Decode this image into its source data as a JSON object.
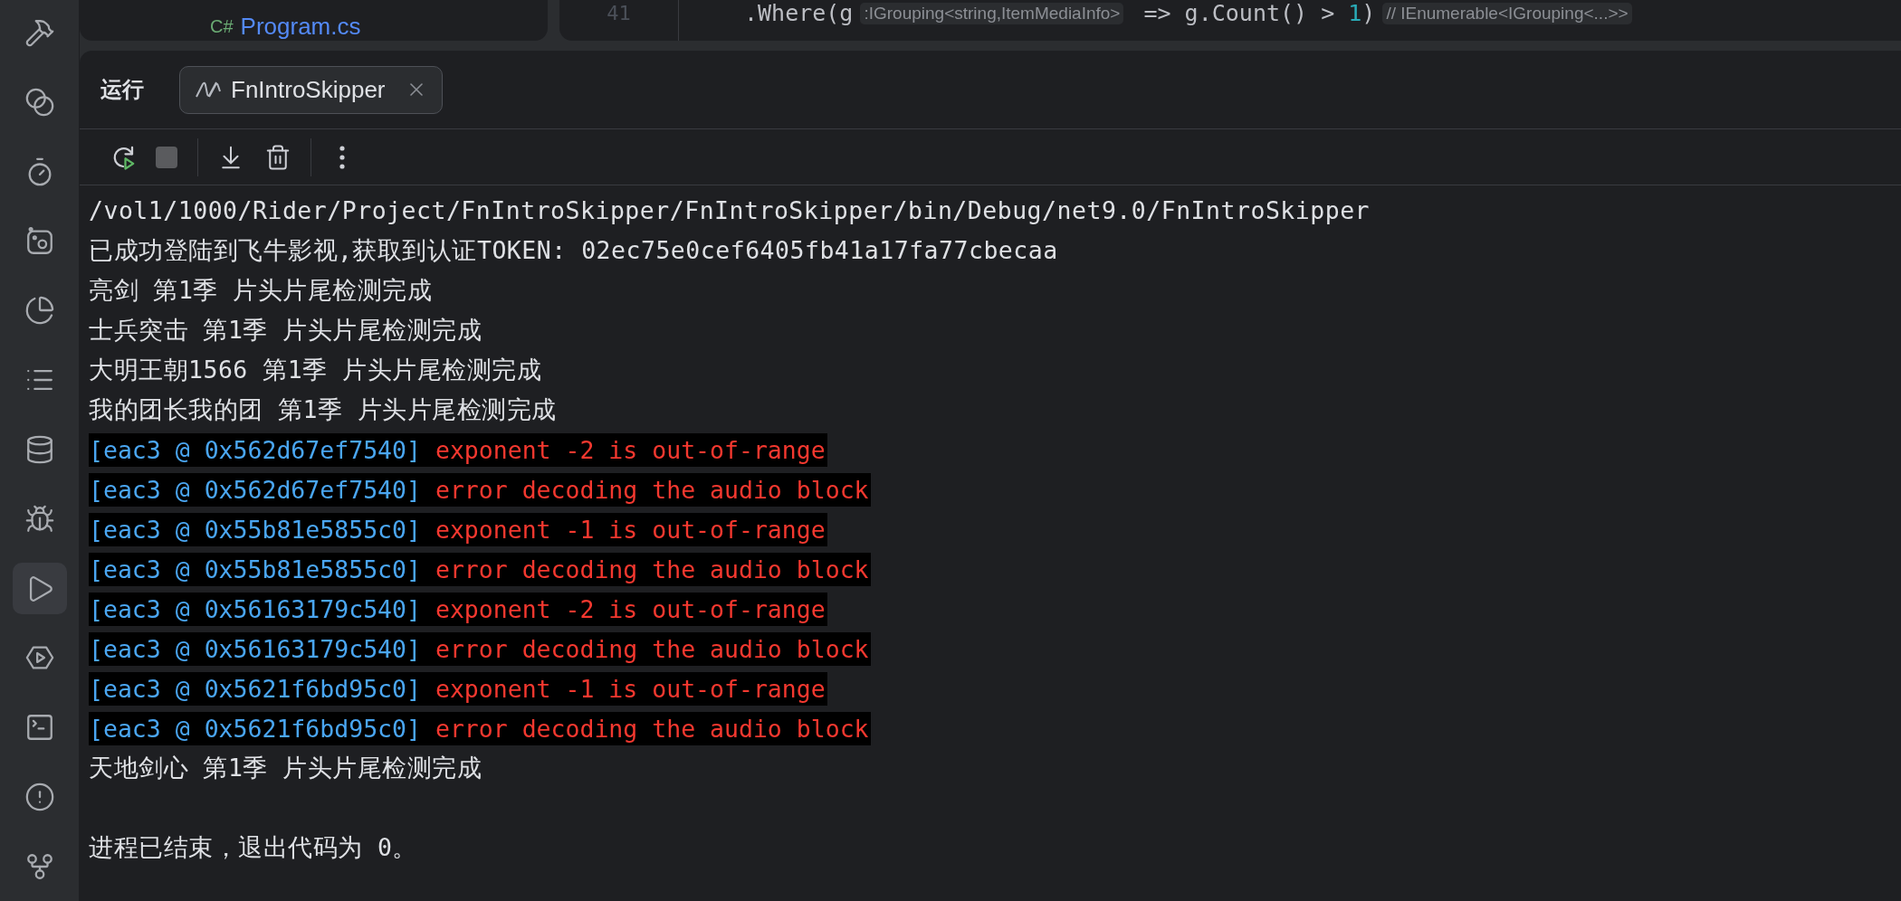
{
  "project_panel": {
    "file": {
      "lang": "C#",
      "name": "Program.cs"
    }
  },
  "editor": {
    "line_number": "41",
    "code_before": ".Where(g",
    "inlay_hint": ":IGrouping<string,ItemMediaInfo>",
    "code_after": "=> g.Count() > ",
    "number": "1",
    "code_end": ")",
    "type_hint": "// IEnumerable<IGrouping<...>>"
  },
  "tool_strip": [
    {
      "kind": "hammer",
      "selected": false
    },
    {
      "kind": "services",
      "selected": false
    },
    {
      "kind": "timer",
      "selected": false
    },
    {
      "kind": "dotsquare",
      "selected": false
    },
    {
      "kind": "pie",
      "selected": false
    },
    {
      "kind": "list",
      "selected": false
    },
    {
      "kind": "database",
      "selected": false
    },
    {
      "kind": "bug",
      "selected": false
    },
    {
      "kind": "run",
      "selected": true
    },
    {
      "kind": "hexplay",
      "selected": false
    },
    {
      "kind": "terminal",
      "selected": false
    },
    {
      "kind": "alert",
      "selected": false
    },
    {
      "kind": "branch",
      "selected": false
    }
  ],
  "run_panel": {
    "title": "运行",
    "tabs": [
      {
        "label": "FnIntroSkipper",
        "selected": true
      }
    ],
    "toolbar": [
      {
        "kind": "rerun"
      },
      {
        "kind": "stop",
        "disabled": true
      },
      {
        "kind": "separator"
      },
      {
        "kind": "scroll"
      },
      {
        "kind": "clear"
      },
      {
        "kind": "separator"
      },
      {
        "kind": "more"
      }
    ],
    "console": [
      {
        "kind": "plain",
        "text": "/vol1/1000/Rider/Project/FnIntroSkipper/FnIntroSkipper/bin/Debug/net9.0/FnIntroSkipper"
      },
      {
        "kind": "plain",
        "text": "已成功登陆到飞牛影视,获取到认证TOKEN: 02ec75e0cef6405fb41a17fa77cbecaa"
      },
      {
        "kind": "plain",
        "text": "亮剑 第1季 片头片尾检测完成"
      },
      {
        "kind": "plain",
        "text": "士兵突击 第1季 片头片尾检测完成"
      },
      {
        "kind": "plain",
        "text": "大明王朝1566 第1季 片头片尾检测完成"
      },
      {
        "kind": "plain",
        "text": "我的团长我的团 第1季 片头片尾检测完成"
      },
      {
        "kind": "error",
        "source": "[eac3 @ 0x562d67ef7540]",
        "text": "exponent -2 is out-of-range"
      },
      {
        "kind": "error",
        "source": "[eac3 @ 0x562d67ef7540]",
        "text": "error decoding the audio block"
      },
      {
        "kind": "error",
        "source": "[eac3 @ 0x55b81e5855c0]",
        "text": "exponent -1 is out-of-range"
      },
      {
        "kind": "error",
        "source": "[eac3 @ 0x55b81e5855c0]",
        "text": "error decoding the audio block"
      },
      {
        "kind": "error",
        "source": "[eac3 @ 0x56163179c540]",
        "text": "exponent -2 is out-of-range"
      },
      {
        "kind": "error",
        "source": "[eac3 @ 0x56163179c540]",
        "text": "error decoding the audio block"
      },
      {
        "kind": "error",
        "source": "[eac3 @ 0x5621f6bd95c0]",
        "text": "exponent -1 is out-of-range"
      },
      {
        "kind": "error",
        "source": "[eac3 @ 0x5621f6bd95c0]",
        "text": "error decoding the audio block"
      },
      {
        "kind": "plain",
        "text": "天地剑心 第1季 片头片尾检测完成"
      }
    ],
    "exit_message": "进程已结束，退出代码为 0。"
  }
}
